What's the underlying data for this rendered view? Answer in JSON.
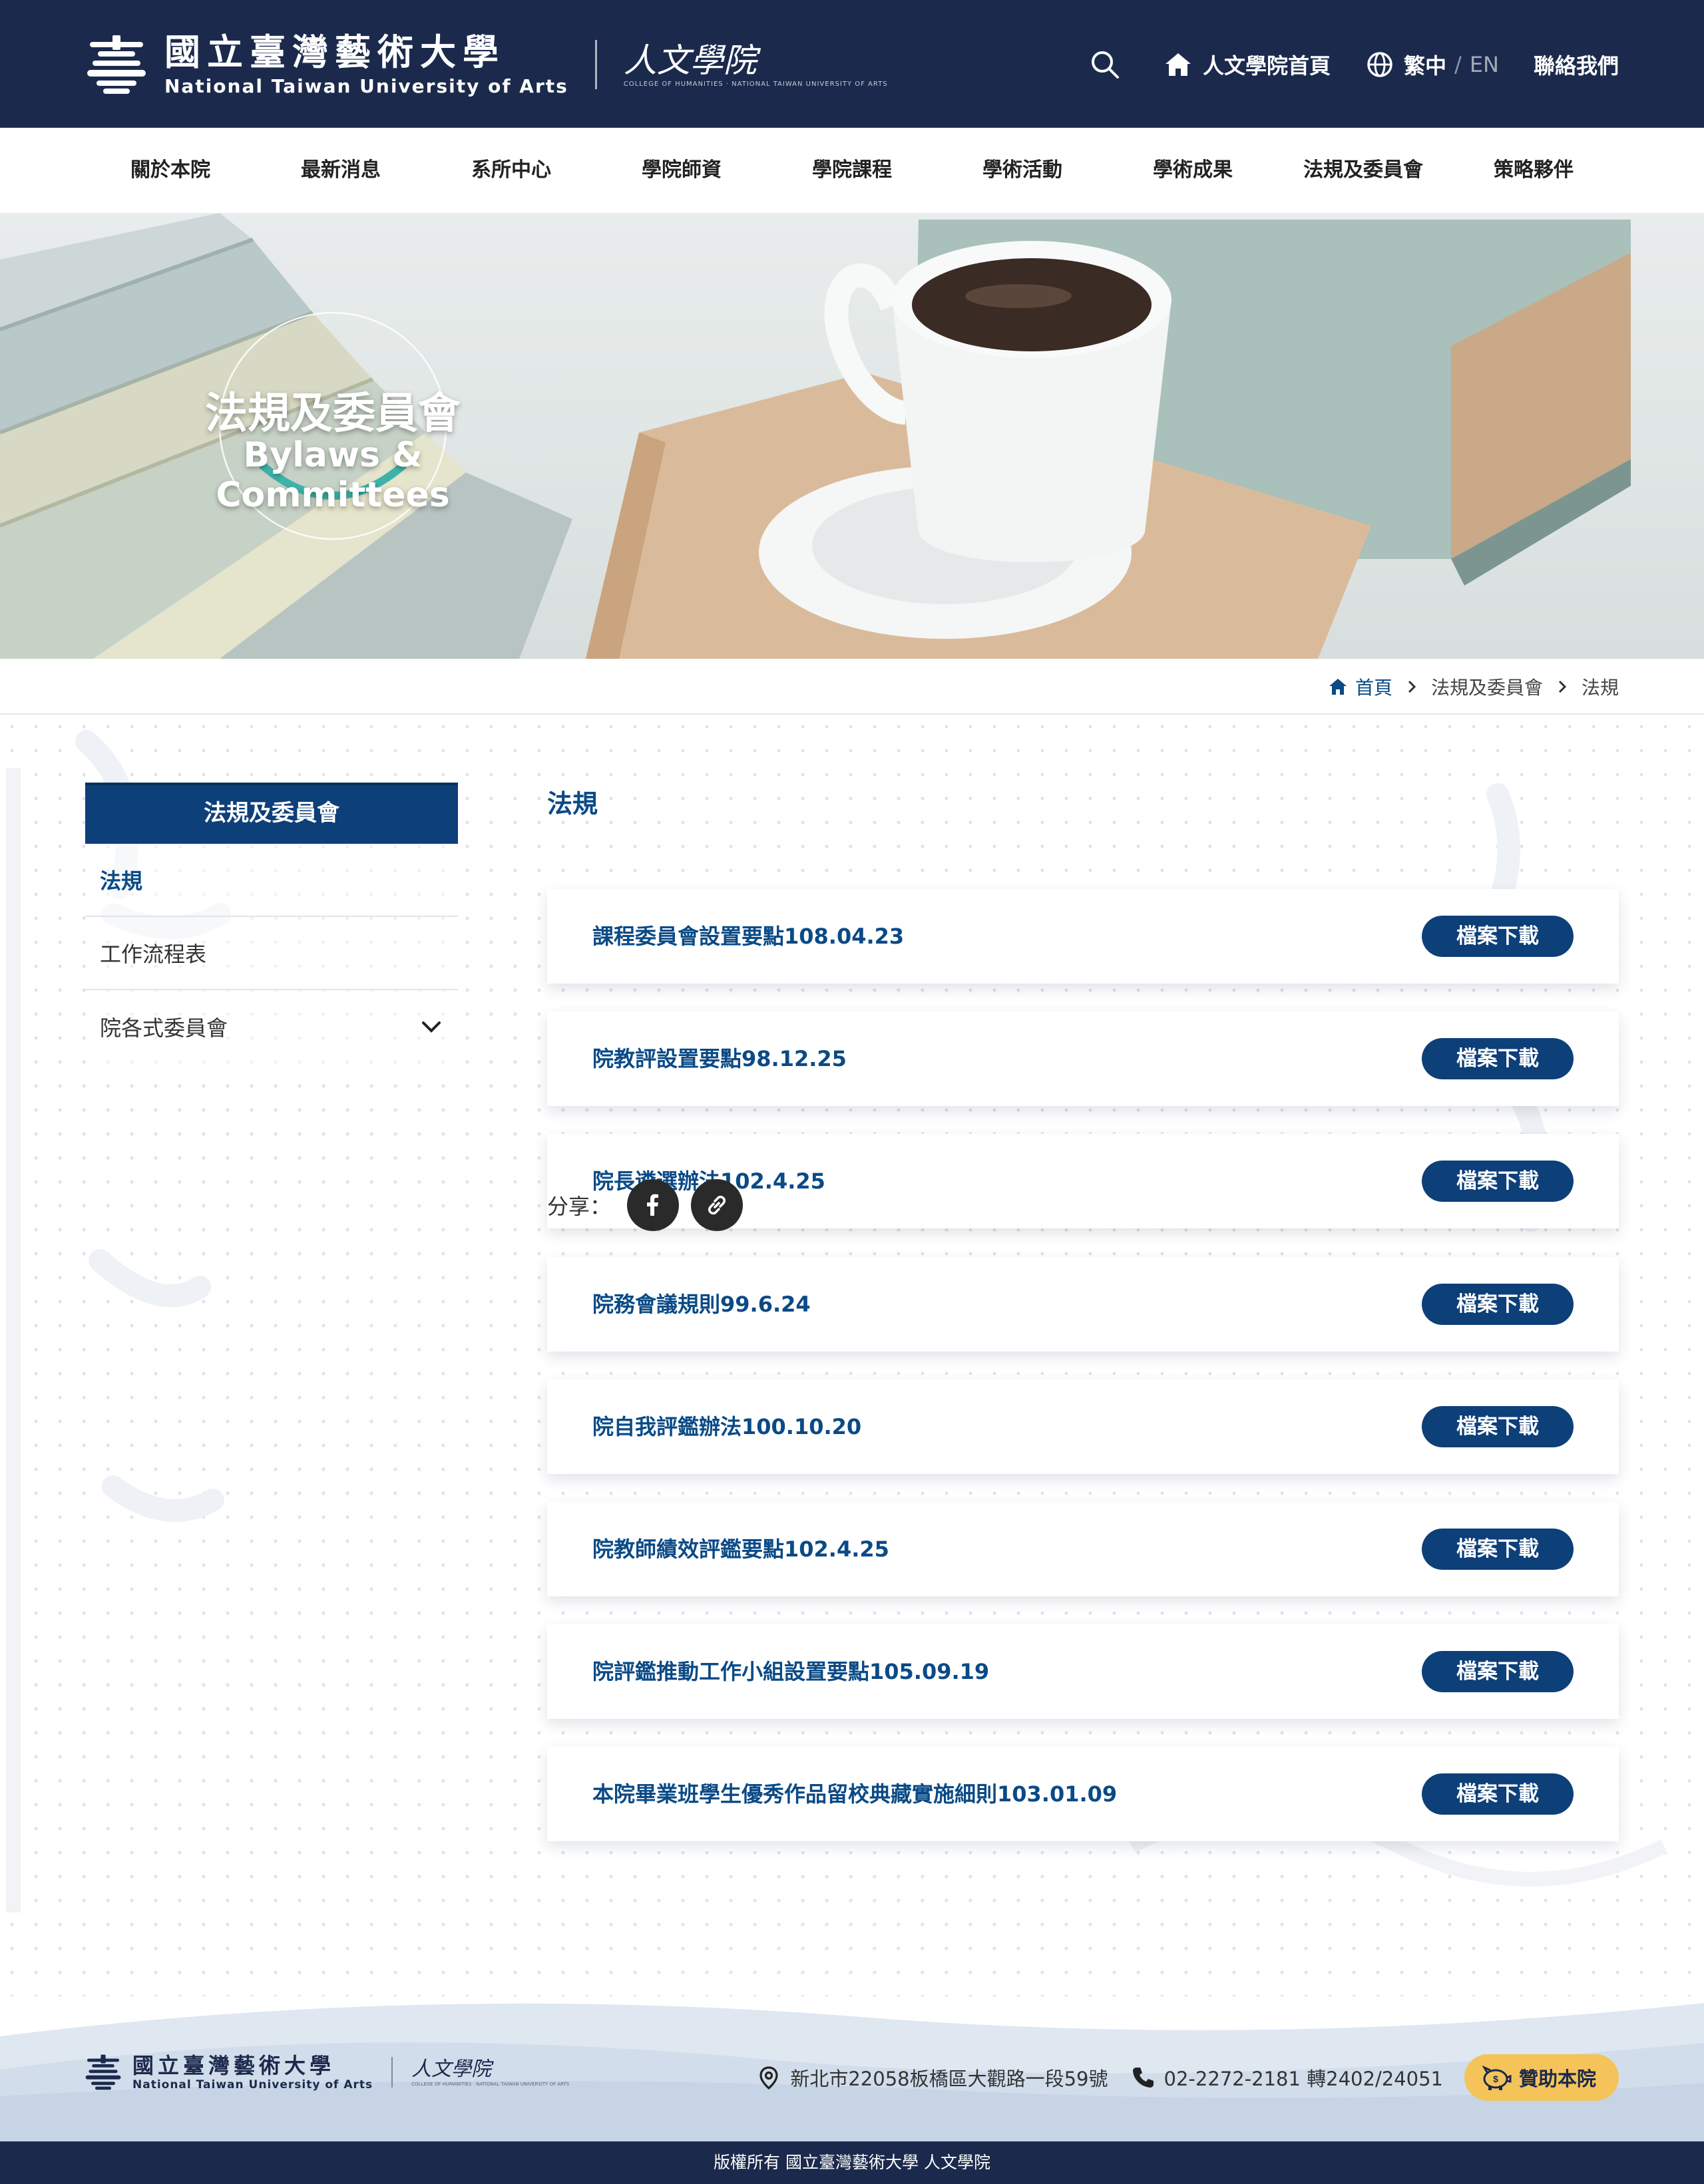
{
  "header": {
    "university_zh": "國立臺灣藝術大學",
    "university_en": "National Taiwan University of Arts",
    "college_zh": "人文學院",
    "college_en": "COLLEGE OF HUMANITIES · NATIONAL TAIWAN UNIVERSITY OF ARTS",
    "home_label": "人文學院首頁",
    "lang_zh": "繁中",
    "lang_sep": "/",
    "lang_en": "EN",
    "contact_label": "聯絡我們"
  },
  "nav": {
    "items": [
      {
        "label": "關於本院"
      },
      {
        "label": "最新消息"
      },
      {
        "label": "系所中心"
      },
      {
        "label": "學院師資"
      },
      {
        "label": "學院課程"
      },
      {
        "label": "學術活動"
      },
      {
        "label": "學術成果"
      },
      {
        "label": "法規及委員會"
      },
      {
        "label": "策略夥伴"
      }
    ]
  },
  "banner": {
    "title_zh": "法規及委員會",
    "title_en": "Bylaws & Committees"
  },
  "breadcrumb": {
    "home": "首頁",
    "level1": "法規及委員會",
    "level2": "法規"
  },
  "sidebar": {
    "heading": "法規及委員會",
    "items": [
      {
        "label": "法規"
      },
      {
        "label": "工作流程表"
      },
      {
        "label": "院各式委員會"
      }
    ]
  },
  "main": {
    "page_title": "法規",
    "download_label": "檔案下載",
    "rules": [
      {
        "title": "課程委員會設置要點108.04.23"
      },
      {
        "title": "院教評設置要點98.12.25"
      },
      {
        "title": "院長遴選辦法102.4.25"
      },
      {
        "title": "院務會議規則99.6.24"
      },
      {
        "title": "院自我評鑑辦法100.10.20"
      },
      {
        "title": "院教師績效評鑑要點102.4.25"
      },
      {
        "title": "院評鑑推動工作小組設置要點105.09.19"
      },
      {
        "title": "本院畢業班學生優秀作品留校典藏實施細則103.01.09"
      }
    ],
    "share_label": "分享："
  },
  "footer": {
    "university_zh": "國立臺灣藝術大學",
    "university_en": "National Taiwan University of Arts",
    "college_zh": "人文學院",
    "address": "新北市22058板橋區大觀路一段59號",
    "phone": "02-2272-2181 轉2402/24051",
    "donate_label": "贊助本院",
    "copyright": "版權所有 國立臺灣藝術大學 人文學院"
  },
  "colors": {
    "header_bg": "#1b2a4c",
    "accent_blue": "#0d3f79",
    "link_blue": "#0a4a86",
    "donate_yellow": "#f4c35a",
    "banner_arc_teal": "#3fb3a9"
  },
  "icons": {
    "search": "search-icon",
    "home": "home-icon",
    "language": "globe-icon",
    "chevron_right": "chevron-right-icon",
    "chevron_down": "chevron-down-icon",
    "facebook": "facebook-icon",
    "copy_link": "link-icon",
    "location": "location-pin-icon",
    "phone": "phone-icon",
    "donate": "piggy-bank-icon"
  }
}
